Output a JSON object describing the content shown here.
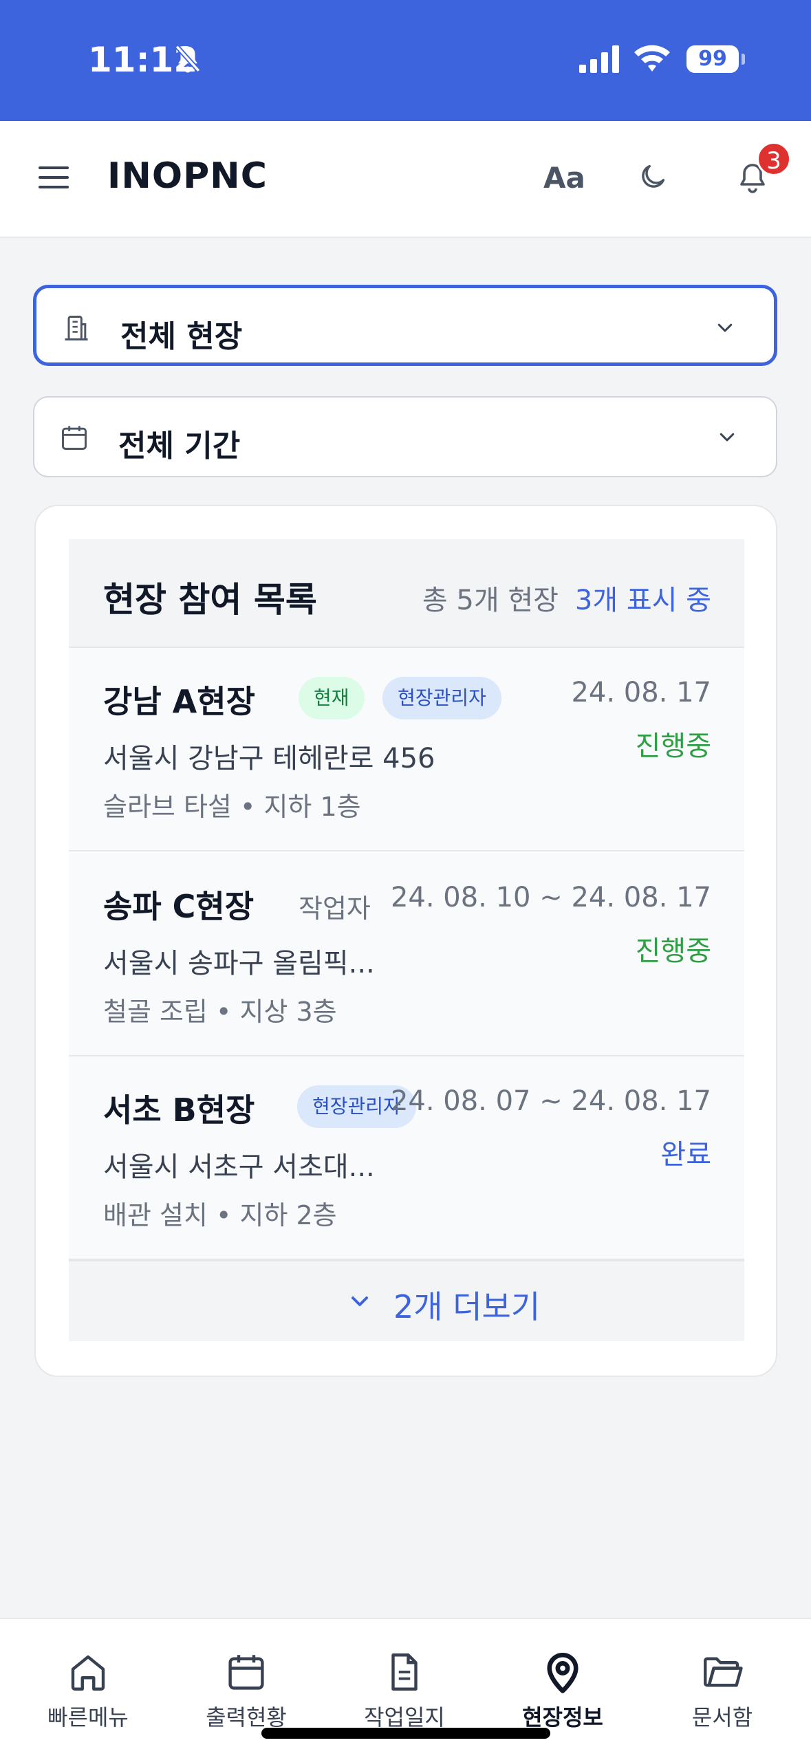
{
  "status_bar": {
    "time": "11:12",
    "battery": "99"
  },
  "header": {
    "title": "INOPNC",
    "font_button": "Aa",
    "notification_count": "3"
  },
  "filters": {
    "site_select": {
      "label": "전체 현장",
      "icon": "building-icon"
    },
    "period_select": {
      "label": "전체 기간",
      "icon": "calendar-icon"
    }
  },
  "card": {
    "title": "현장 참여 목록",
    "count": "총 5개 현장",
    "showing": "3개 표시 중",
    "more": "2개 더보기",
    "sites": [
      {
        "name": "강남 A현장",
        "badges": [
          "현재",
          "현장관리자"
        ],
        "date": "24. 08. 17",
        "status": "진행중",
        "address": "서울시 강남구 테헤란로 456",
        "work": "슬라브 타설 • 지하 1층"
      },
      {
        "name": "송파 C현장",
        "role": "작업자",
        "date": "24. 08. 10 ~ 24. 08. 17",
        "status": "진행중",
        "address": "서울시 송파구 올림픽...",
        "work": "철골 조립 • 지상 3층"
      },
      {
        "name": "서초 B현장",
        "badges": [
          "현장관리자"
        ],
        "date": "24. 08. 07 ~ 24. 08. 17",
        "status": "완료",
        "address": "서울시 서초구 서초대...",
        "work": "배관 설치 • 지하 2층"
      }
    ]
  },
  "bottom_nav": [
    {
      "label": "빠른메뉴",
      "icon": "home-icon"
    },
    {
      "label": "출력현황",
      "icon": "calendar-icon"
    },
    {
      "label": "작업일지",
      "icon": "document-icon"
    },
    {
      "label": "현장정보",
      "icon": "location-pin-icon",
      "active": true
    },
    {
      "label": "문서함",
      "icon": "folder-icon"
    }
  ],
  "colors": {
    "accent": "#3d63dd",
    "status_active": "#2f9e44",
    "status_done": "#3d63dd",
    "badge_red": "#e03131"
  }
}
